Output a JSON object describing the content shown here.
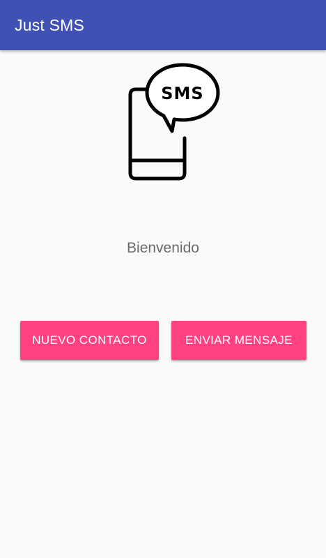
{
  "app_bar": {
    "title": "Just SMS",
    "color": "#3f51b5"
  },
  "illustration": {
    "icon": "phone-sms-icon",
    "bubble_text": "SMS"
  },
  "welcome_text": "Bienvenido",
  "buttons": {
    "new_contact_label": "NUEVO CONTACTO",
    "send_message_label": "ENVIAR MENSAJE",
    "color": "#ff4081"
  }
}
